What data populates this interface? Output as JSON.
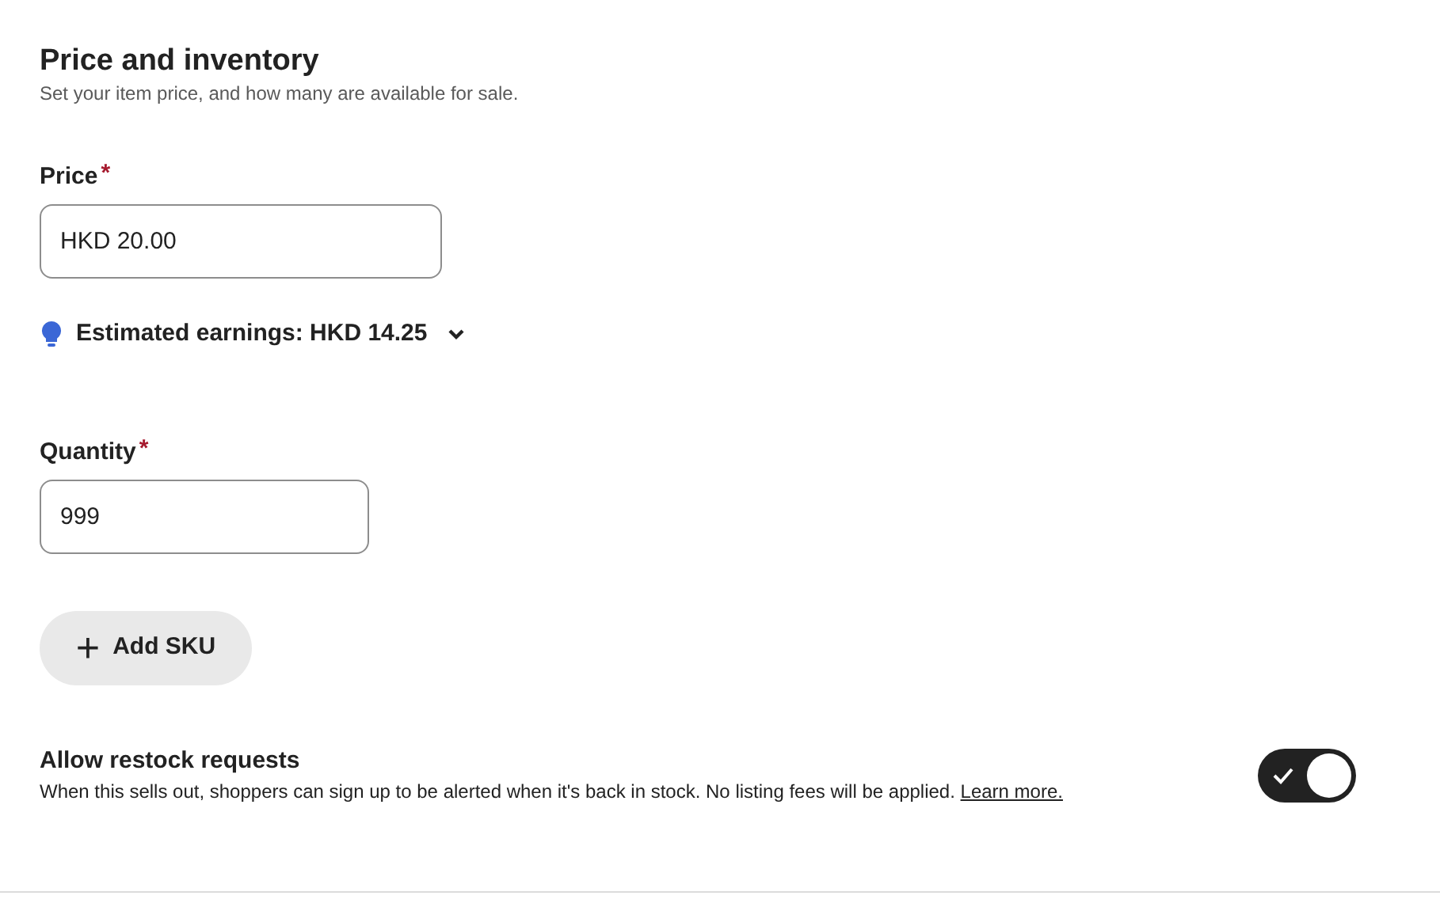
{
  "section": {
    "title": "Price and inventory",
    "subtitle": "Set your item price, and how many are available for sale."
  },
  "price": {
    "label": "Price",
    "required_mark": "*",
    "value": "HKD 20.00"
  },
  "earnings": {
    "text": "Estimated earnings: HKD 14.25",
    "expanded": false
  },
  "quantity": {
    "label": "Quantity",
    "required_mark": "*",
    "value": "999"
  },
  "add_sku": {
    "icon": "+",
    "label": "Add SKU"
  },
  "restock": {
    "title": "Allow restock requests",
    "description": "When this sells out, shoppers can sign up to be alerted when it's back in stock. No listing fees will be applied.",
    "link": "Learn more.",
    "on": true
  }
}
